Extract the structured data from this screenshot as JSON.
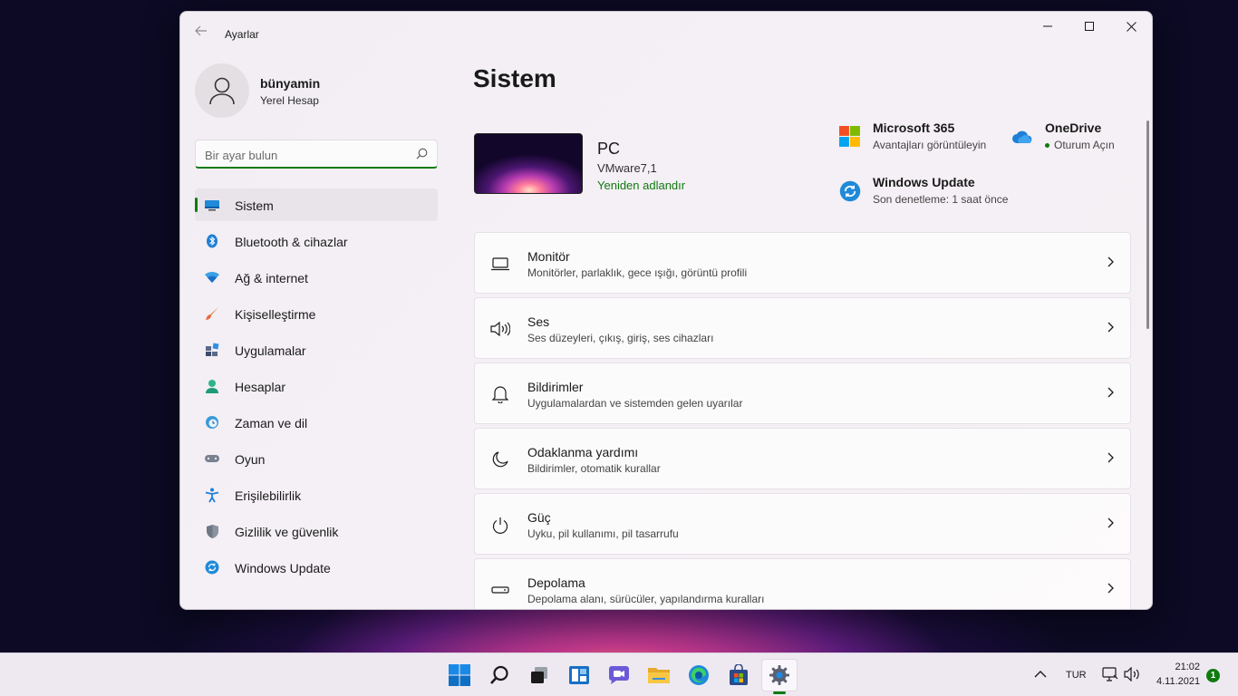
{
  "window": {
    "app_title": "Ayarlar",
    "back_icon": "arrow-left-icon",
    "controls": [
      "minimize-icon",
      "maximize-icon",
      "close-icon"
    ]
  },
  "profile": {
    "name": "bünyamin",
    "account_type": "Yerel Hesap"
  },
  "search": {
    "placeholder": "Bir ayar bulun",
    "value": ""
  },
  "sidebar": {
    "active_index": 0,
    "items": [
      {
        "label": "Sistem",
        "icon": "monitor-icon"
      },
      {
        "label": "Bluetooth & cihazlar",
        "icon": "bluetooth-icon"
      },
      {
        "label": "Ağ & internet",
        "icon": "wifi-icon"
      },
      {
        "label": "Kişiselleştirme",
        "icon": "brush-icon"
      },
      {
        "label": "Uygulamalar",
        "icon": "apps-icon"
      },
      {
        "label": "Hesaplar",
        "icon": "person-icon"
      },
      {
        "label": "Zaman ve dil",
        "icon": "clock-globe-icon"
      },
      {
        "label": "Oyun",
        "icon": "gamepad-icon"
      },
      {
        "label": "Erişilebilirlik",
        "icon": "accessibility-icon"
      },
      {
        "label": "Gizlilik ve güvenlik",
        "icon": "shield-icon"
      },
      {
        "label": "Windows Update",
        "icon": "update-icon"
      }
    ]
  },
  "main": {
    "title": "Sistem",
    "device": {
      "name": "PC",
      "model": "VMware7,1",
      "rename_label": "Yeniden adlandır"
    },
    "quick": {
      "m365": {
        "title": "Microsoft 365",
        "subtitle": "Avantajları görüntüleyin"
      },
      "onedrive": {
        "title": "OneDrive",
        "subtitle": "Oturum Açın"
      },
      "update": {
        "title": "Windows Update",
        "subtitle": "Son denetleme: 1 saat önce"
      }
    },
    "cards": [
      {
        "title": "Monitör",
        "subtitle": "Monitörler, parlaklık, gece ışığı, görüntü profili",
        "icon": "display-icon"
      },
      {
        "title": "Ses",
        "subtitle": "Ses düzeyleri, çıkış, giriş, ses cihazları",
        "icon": "speaker-icon"
      },
      {
        "title": "Bildirimler",
        "subtitle": "Uygulamalardan ve sistemden gelen uyarılar",
        "icon": "bell-icon"
      },
      {
        "title": "Odaklanma yardımı",
        "subtitle": "Bildirimler, otomatik kurallar",
        "icon": "moon-icon"
      },
      {
        "title": "Güç",
        "subtitle": "Uyku, pil kullanımı, pil tasarrufu",
        "icon": "power-icon"
      },
      {
        "title": "Depolama",
        "subtitle": "Depolama alanı, sürücüler, yapılandırma kuralları",
        "icon": "drive-icon"
      }
    ]
  },
  "taskbar": {
    "icons": [
      "windows-start-icon",
      "search-icon",
      "task-view-icon",
      "widgets-icon",
      "chat-icon",
      "file-explorer-icon",
      "edge-icon",
      "store-icon",
      "settings-icon"
    ],
    "active": "settings-icon",
    "tray": {
      "language": "TUR",
      "time": "21:02",
      "date": "4.11.2021",
      "notifications": "1"
    }
  },
  "colors": {
    "accent": "#0f7b0f",
    "window_bg": "#f3eff4",
    "taskbar_bg": "#eee9f1"
  }
}
